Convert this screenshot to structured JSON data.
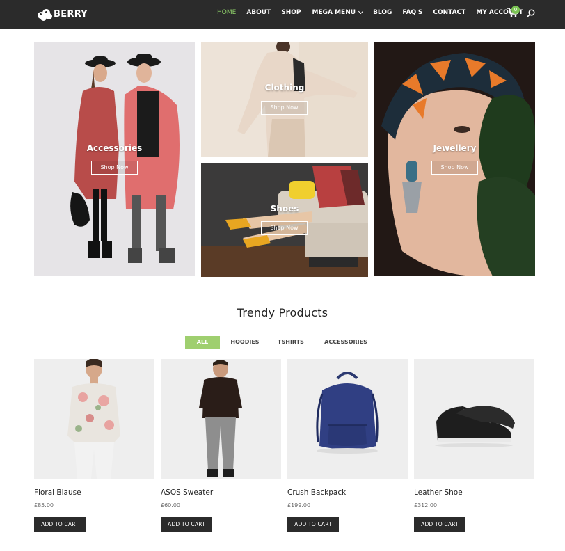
{
  "header": {
    "logo_text": "BERRY",
    "nav": [
      {
        "label": "HOME",
        "active": true
      },
      {
        "label": "ABOUT"
      },
      {
        "label": "SHOP"
      },
      {
        "label": "MEGA MENU",
        "has_dropdown": true
      },
      {
        "label": "BLOG"
      },
      {
        "label": "FAQ'S"
      },
      {
        "label": "CONTACT"
      },
      {
        "label": "MY ACCOUNT"
      }
    ],
    "cart_count": "0",
    "icons": [
      "cart-icon",
      "search-icon"
    ]
  },
  "banners": [
    {
      "label": "Accessories",
      "button": "Shop Now"
    },
    {
      "label": "Clothing",
      "button": "Shop Now"
    },
    {
      "label": "Shoes",
      "button": "Shop Now"
    },
    {
      "label": "Jewellery",
      "button": "Shop Now"
    }
  ],
  "section": {
    "title": "Trendy Products",
    "filters": [
      {
        "label": "ALL",
        "active": true
      },
      {
        "label": "HOODIES"
      },
      {
        "label": "TSHIRTS"
      },
      {
        "label": "ACCESSORIES"
      }
    ]
  },
  "products": [
    {
      "name": "Floral Blause",
      "price": "£85.00",
      "button": "ADD TO CART"
    },
    {
      "name": "ASOS Sweater",
      "price": "£60.00",
      "button": "ADD TO CART"
    },
    {
      "name": "Crush Backpack",
      "price": "£199.00",
      "button": "ADD TO CART"
    },
    {
      "name": "Leather Shoe",
      "price": "£312.00",
      "button": "ADD TO CART"
    }
  ],
  "colors": {
    "header_bg": "#2b2b2b",
    "accent": "#8fd16a",
    "filter_active": "#9fcf6f",
    "button_dark": "#2b2b2b"
  }
}
